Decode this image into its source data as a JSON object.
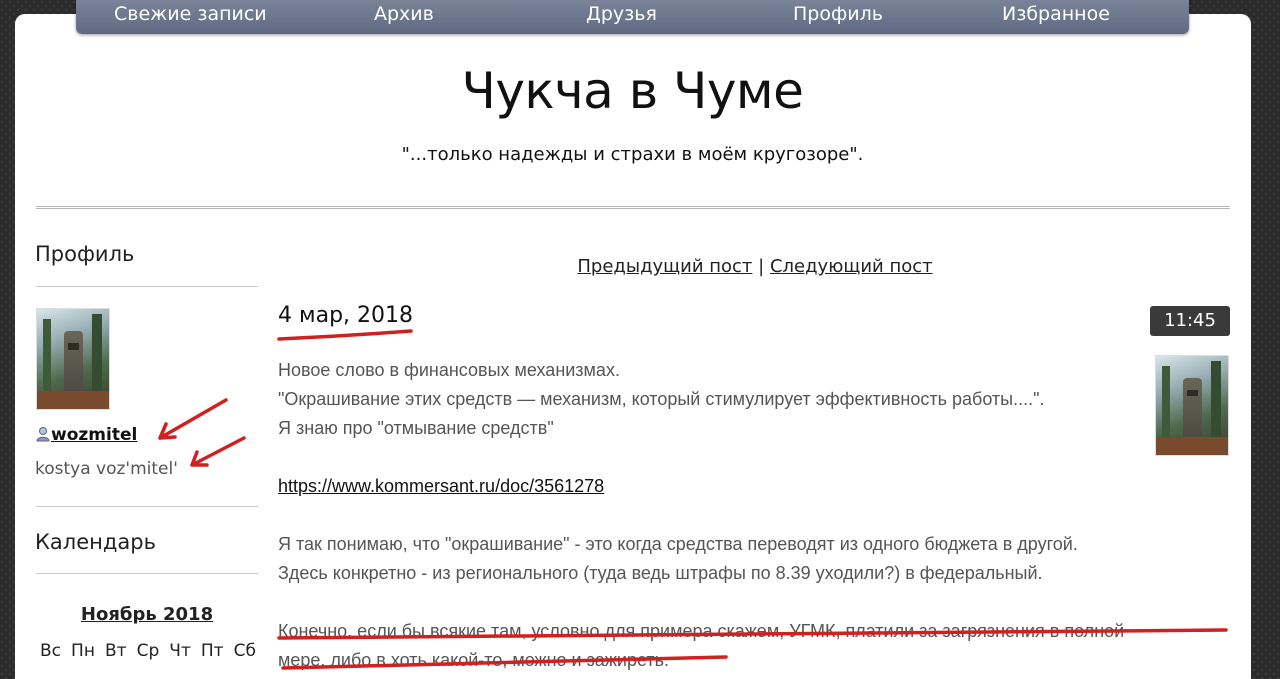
{
  "nav": {
    "items": [
      "Свежие записи",
      "Архив",
      "Друзья",
      "Профиль",
      "Избранное"
    ]
  },
  "site": {
    "title": "Чукча в Чуме",
    "subtitle": "\"...только надежды и страхи в моём кругозоре\"."
  },
  "sidebar": {
    "profile_heading": "Профиль",
    "username": "wozmitel",
    "fullname": "kostya voz'mitel'",
    "calendar_heading": "Календарь",
    "calendar_month": "Ноябрь 2018",
    "weekdays": [
      "Вс",
      "Пн",
      "Вт",
      "Ср",
      "Чт",
      "Пт",
      "Сб"
    ]
  },
  "post_nav": {
    "prev": "Предыдущий пост",
    "separator": "|",
    "next": "Следующий пост"
  },
  "post": {
    "date": "4 мар, 2018",
    "time": "11:45",
    "lines": [
      "Новое слово в финансовых механизмах.",
      "\"Окрашивание этих средств — механизм, который стимулирует эффективность работы....\".",
      "Я знаю про \"отмывание средств\""
    ],
    "link": "https://www.kommersant.ru/doc/3561278",
    "para2": [
      "Я так понимаю, что \"окрашивание\" - это когда средства переводят из одного бюджета в другой.",
      "Здесь конкретно - из регионального (туда ведь штрафы по 8.39 уходили?) в федеральный."
    ],
    "para3": [
      "Конечно, если бы всякие там, условно для примера скажем, УГМК, платили за загрязнения в полной",
      "мере, либо в хоть какой-то, можно и зажиреть."
    ]
  },
  "colors": {
    "nav_bg": "#6b7490",
    "annotation_red": "#d21f1f",
    "time_badge": "#3a3a3a"
  }
}
